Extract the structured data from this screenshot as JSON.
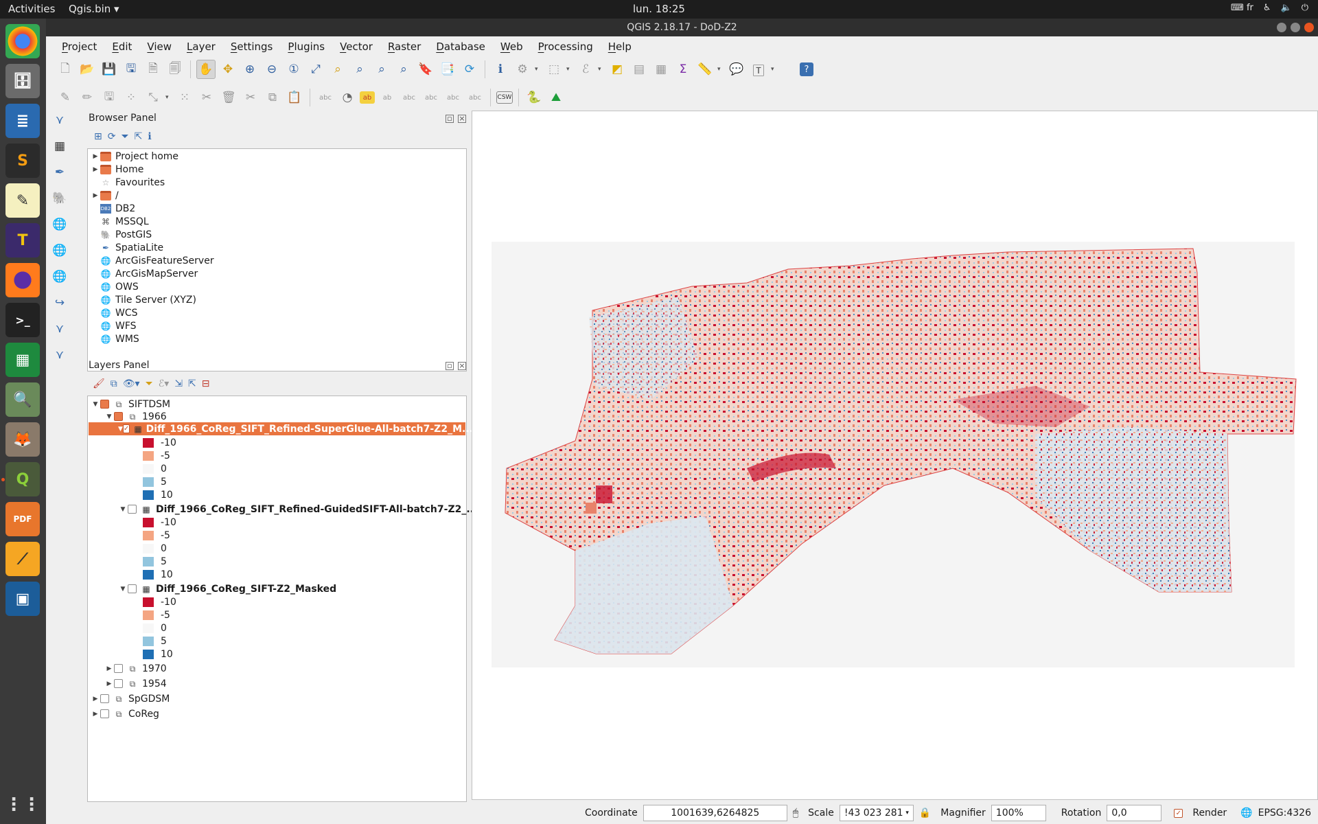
{
  "topbar": {
    "activities": "Activities",
    "app_menu": "Qgis.bin ▾",
    "clock": "lun. 18:25",
    "keyboard": "fr"
  },
  "window": {
    "title": "QGIS 2.18.17 - DoD-Z2"
  },
  "menubar": [
    "Project",
    "Edit",
    "View",
    "Layer",
    "Settings",
    "Plugins",
    "Vector",
    "Raster",
    "Database",
    "Web",
    "Processing",
    "Help"
  ],
  "browser_panel": {
    "title": "Browser Panel",
    "items": [
      {
        "label": "Project home",
        "icon": "folder",
        "expandable": true
      },
      {
        "label": "Home",
        "icon": "folder",
        "expandable": true
      },
      {
        "label": "Favourites",
        "icon": "star",
        "expandable": false
      },
      {
        "label": "/",
        "icon": "folder",
        "expandable": true
      },
      {
        "label": "DB2",
        "icon": "db2",
        "expandable": false
      },
      {
        "label": "MSSQL",
        "icon": "mssql",
        "expandable": false
      },
      {
        "label": "PostGIS",
        "icon": "postgis",
        "expandable": false
      },
      {
        "label": "SpatiaLite",
        "icon": "spatialite",
        "expandable": false
      },
      {
        "label": "ArcGisFeatureServer",
        "icon": "globe",
        "expandable": false
      },
      {
        "label": "ArcGisMapServer",
        "icon": "globe",
        "expandable": false
      },
      {
        "label": "OWS",
        "icon": "globe",
        "expandable": false
      },
      {
        "label": "Tile Server (XYZ)",
        "icon": "globe",
        "expandable": false
      },
      {
        "label": "WCS",
        "icon": "globe",
        "expandable": false
      },
      {
        "label": "WFS",
        "icon": "globe",
        "expandable": false
      },
      {
        "label": "WMS",
        "icon": "globe",
        "expandable": false
      }
    ]
  },
  "layers_panel": {
    "title": "Layers Panel",
    "group_siftdsm": "SIFTDSM",
    "group_1966": "1966",
    "layer_1": "Diff_1966_CoReg_SIFT_Refined-SuperGlue-All-batch7-Z2_M...",
    "layer_2": "Diff_1966_CoReg_SIFT_Refined-GuidedSIFT-All-batch7-Z2_...",
    "layer_3": "Diff_1966_CoReg_SIFT-Z2_Masked",
    "legend": [
      {
        "label": "-10",
        "color": "#c8102e"
      },
      {
        "label": "-5",
        "color": "#f4a582"
      },
      {
        "label": "0",
        "color": "#f7f7f7"
      },
      {
        "label": "5",
        "color": "#92c5de"
      },
      {
        "label": "10",
        "color": "#1f6fb4"
      }
    ],
    "group_1970": "1970",
    "group_1954": "1954",
    "group_spgdsm": "SpGDSM",
    "group_coreg": "CoReg"
  },
  "statusbar": {
    "coordinate_label": "Coordinate",
    "coordinate_value": "1001639,6264825",
    "scale_label": "Scale",
    "scale_value": "!43 023 281",
    "magnifier_label": "Magnifier",
    "magnifier_value": "100%",
    "rotation_label": "Rotation",
    "rotation_value": "0,0",
    "render_label": "Render",
    "crs": "EPSG:4326"
  },
  "colors": {
    "accent": "#e9743f",
    "dark_red": "#c8102e",
    "blue": "#1f6fb4"
  }
}
